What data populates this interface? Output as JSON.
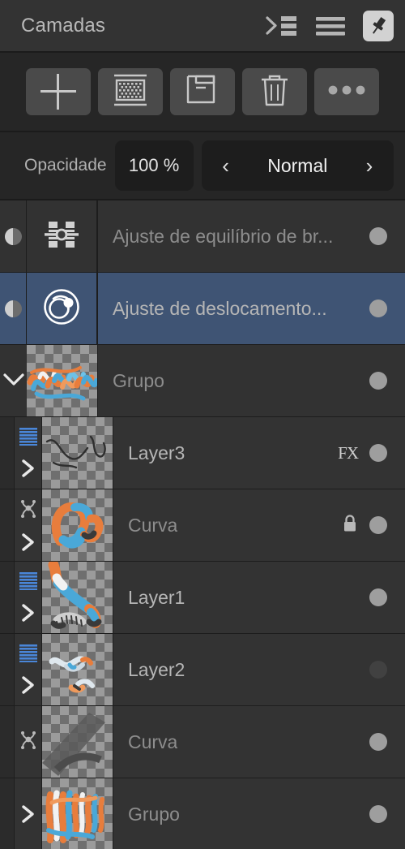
{
  "header": {
    "title": "Camadas",
    "actions": [
      {
        "name": "indent-list-icon",
        "label": "Indentar lista"
      },
      {
        "name": "menu-icon",
        "label": "Menu"
      },
      {
        "name": "pin-icon",
        "label": "Fixar painel"
      }
    ]
  },
  "toolbar": {
    "buttons": [
      {
        "name": "add-layer-button",
        "icon": "plus-icon",
        "label": "Adicionar"
      },
      {
        "name": "mask-layer-button",
        "icon": "mask-icon",
        "label": "Máscara"
      },
      {
        "name": "duplicate-layer-button",
        "icon": "duplicate-icon",
        "label": "Duplicar"
      },
      {
        "name": "delete-layer-button",
        "icon": "trash-icon",
        "label": "Excluir"
      },
      {
        "name": "more-options-button",
        "icon": "ellipsis-icon",
        "label": "Mais"
      }
    ]
  },
  "options": {
    "opacity_label": "Opacidade",
    "opacity_value": "100 %",
    "blend_prev": "‹",
    "blend_mode": "Normal",
    "blend_next": "›"
  },
  "colors": {
    "panel_bg": "#2b2b2b",
    "row_bg": "#323232",
    "selected_row": "#3f5474",
    "text_dim": "#8d8d8d",
    "text_bright": "#ffffff",
    "accent_blue": "#4a86d8"
  },
  "layers": [
    {
      "name": "Ajuste de equilíbrio de br...",
      "type": "adjustment",
      "level": 0,
      "icon": "balance-adjustment-icon",
      "selected": false,
      "visible": true,
      "expanded": null,
      "fx": false,
      "locked": false,
      "dimmed": true
    },
    {
      "name": "Ajuste de deslocamento...",
      "type": "adjustment",
      "level": 0,
      "icon": "shift-adjustment-icon",
      "selected": true,
      "visible": true,
      "expanded": null,
      "fx": false,
      "locked": false,
      "dimmed": false
    },
    {
      "name": "Grupo",
      "type": "group",
      "level": 0,
      "icon": "group-icon",
      "selected": false,
      "visible": true,
      "expanded": true,
      "fx": false,
      "locked": false,
      "dimmed": true,
      "thumb": "ribbons-wide"
    },
    {
      "name": "Layer3",
      "type": "pixel",
      "level": 1,
      "icon": "pixel-layer-icon",
      "selected": false,
      "visible": true,
      "expanded": false,
      "fx": true,
      "locked": false,
      "dimmed": false,
      "thumb": "sketch-lines"
    },
    {
      "name": "Curva",
      "type": "curve",
      "level": 1,
      "icon": "curve-icon",
      "selected": false,
      "visible": true,
      "expanded": false,
      "fx": false,
      "locked": true,
      "dimmed": true,
      "thumb": "ribbon-loop"
    },
    {
      "name": "Layer1",
      "type": "pixel",
      "level": 1,
      "icon": "pixel-layer-icon",
      "selected": false,
      "visible": true,
      "expanded": false,
      "fx": false,
      "locked": false,
      "dimmed": false,
      "thumb": "ribbon-diagonal"
    },
    {
      "name": "Layer2",
      "type": "pixel",
      "level": 1,
      "icon": "pixel-layer-icon",
      "selected": false,
      "visible": false,
      "expanded": false,
      "fx": false,
      "locked": false,
      "dimmed": false,
      "thumb": "ribbon-small"
    },
    {
      "name": "Curva",
      "type": "curve",
      "level": 1,
      "icon": "curve-icon",
      "selected": false,
      "visible": true,
      "expanded": null,
      "fx": false,
      "locked": false,
      "dimmed": true,
      "thumb": "curve-band"
    },
    {
      "name": "Grupo",
      "type": "group",
      "level": 1,
      "icon": "group-icon",
      "selected": false,
      "visible": true,
      "expanded": false,
      "fx": false,
      "locked": false,
      "dimmed": true,
      "thumb": "ribbons-dense"
    }
  ]
}
